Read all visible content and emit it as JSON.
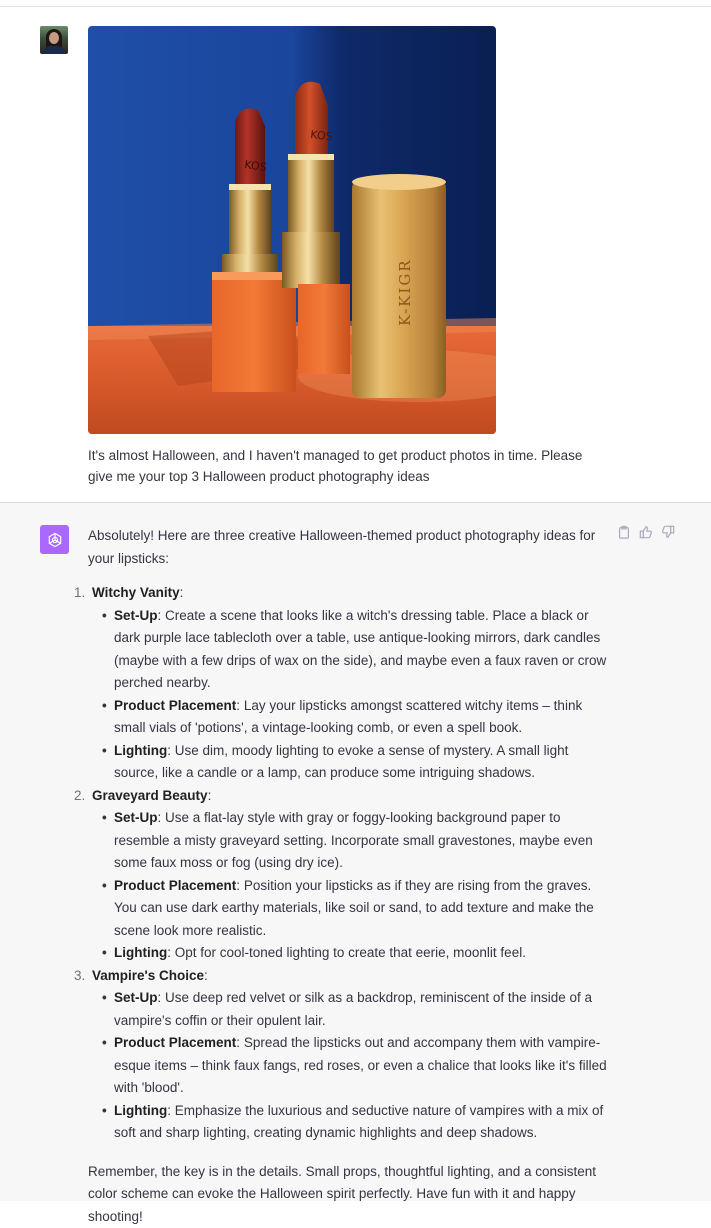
{
  "user_message": {
    "text": "It's almost Halloween, and I haven't managed to get product photos in time. Please give me your top 3 Halloween product photography ideas",
    "image": {
      "lipstick_brand_text": "KOS",
      "case_text": "K-KIGR"
    }
  },
  "assistant_message": {
    "intro": "Absolutely! Here are three creative Halloween-themed product photography ideas for your lipsticks:",
    "ideas": [
      {
        "number": "1.",
        "title": "Witchy Vanity",
        "points": [
          {
            "label": "Set-Up",
            "text": "Create a scene that looks like a witch's dressing table. Place a black or dark purple lace tablecloth over a table, use antique-looking mirrors, dark candles (maybe with a few drips of wax on the side), and maybe even a faux raven or crow perched nearby."
          },
          {
            "label": "Product Placement",
            "text": "Lay your lipsticks amongst scattered witchy items – think small vials of 'potions', a vintage-looking comb, or even a spell book."
          },
          {
            "label": "Lighting",
            "text": "Use dim, moody lighting to evoke a sense of mystery. A small light source, like a candle or a lamp, can produce some intriguing shadows."
          }
        ]
      },
      {
        "number": "2.",
        "title": "Graveyard Beauty",
        "points": [
          {
            "label": "Set-Up",
            "text": "Use a flat-lay style with gray or foggy-looking background paper to resemble a misty graveyard setting. Incorporate small gravestones, maybe even some faux moss or fog (using dry ice)."
          },
          {
            "label": "Product Placement",
            "text": "Position your lipsticks as if they are rising from the graves. You can use dark earthy materials, like soil or sand, to add texture and make the scene look more realistic."
          },
          {
            "label": "Lighting",
            "text": "Opt for cool-toned lighting to create that eerie, moonlit feel."
          }
        ]
      },
      {
        "number": "3.",
        "title": "Vampire's Choice",
        "points": [
          {
            "label": "Set-Up",
            "text": "Use deep red velvet or silk as a backdrop, reminiscent of the inside of a vampire's coffin or their opulent lair."
          },
          {
            "label": "Product Placement",
            "text": "Spread the lipsticks out and accompany them with vampire-esque items – think faux fangs, red roses, or even a chalice that looks like it's filled with 'blood'."
          },
          {
            "label": "Lighting",
            "text": "Emphasize the luxurious and seductive nature of vampires with a mix of soft and sharp lighting, creating dynamic highlights and deep shadows."
          }
        ]
      }
    ],
    "closing": "Remember, the key is in the details. Small props, thoughtful lighting, and a consistent color scheme can evoke the Halloween spirit perfectly. Have fun with it and happy shooting!"
  },
  "colors": {
    "assistant_avatar": "#ab68ff",
    "assistant_bg": "#f7f7f8",
    "text": "#343541"
  },
  "icons": {
    "copy": "clipboard-icon",
    "thumbs_up": "thumbs-up-icon",
    "thumbs_down": "thumbs-down-icon",
    "assistant_logo": "openai-logo-icon"
  }
}
